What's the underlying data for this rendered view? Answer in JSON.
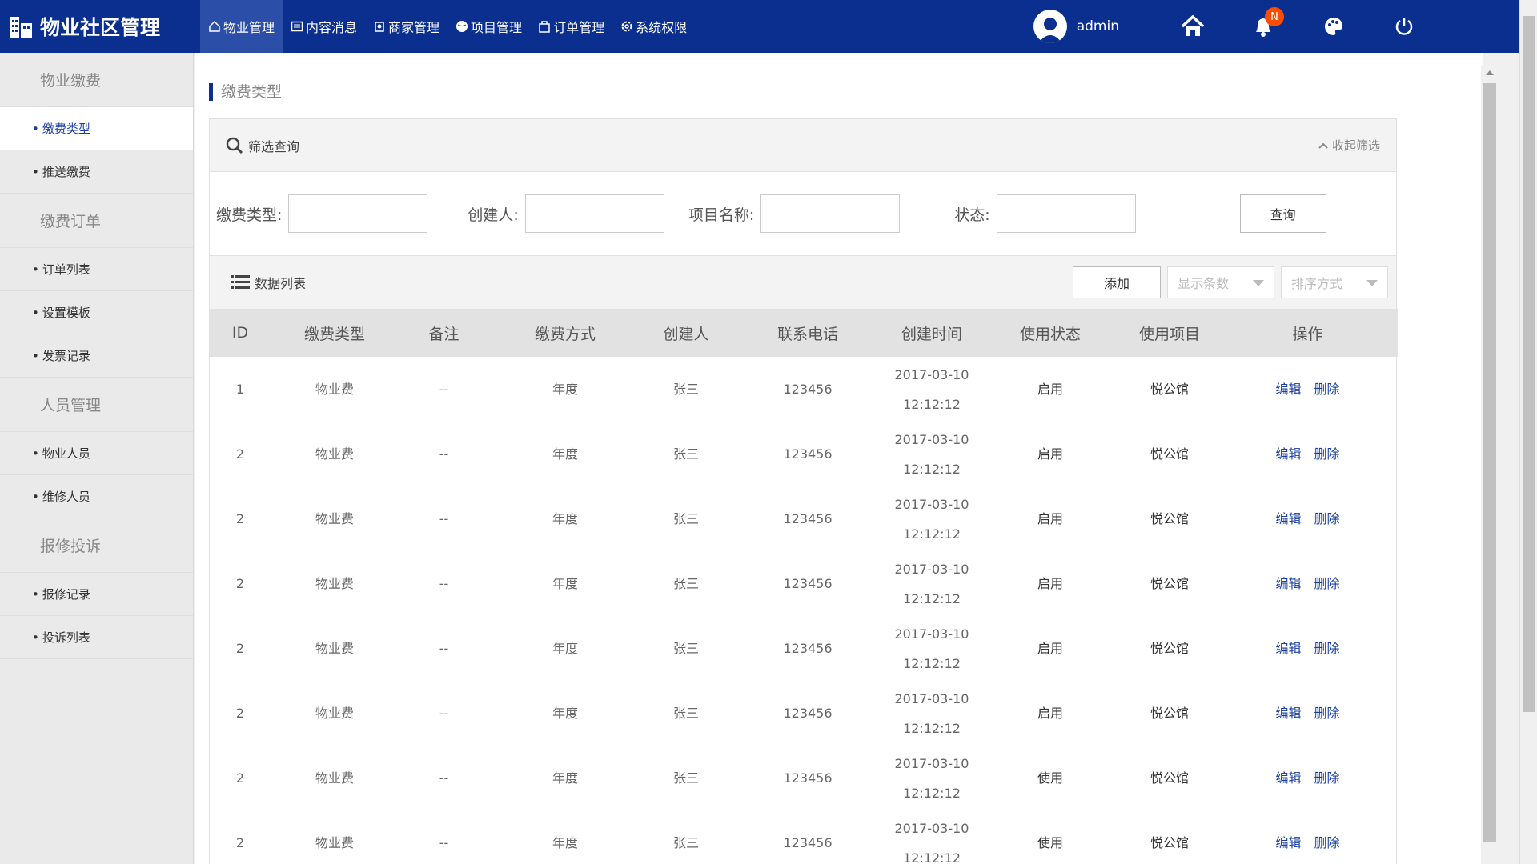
{
  "app": {
    "title": "物业社区管理"
  },
  "nav": {
    "items": [
      {
        "label": "物业管理",
        "icon": "home-outline-icon"
      },
      {
        "label": "内容消息",
        "icon": "message-icon"
      },
      {
        "label": "商家管理",
        "icon": "shop-icon"
      },
      {
        "label": "项目管理",
        "icon": "globe-icon"
      },
      {
        "label": "订单管理",
        "icon": "bag-icon"
      },
      {
        "label": "系统权限",
        "icon": "gear-icon"
      }
    ]
  },
  "user": {
    "name": "admin",
    "notifications_badge": "N"
  },
  "sidebar": {
    "groups": [
      {
        "title": "物业缴费",
        "items": [
          "缴费类型",
          "推送缴费"
        ]
      },
      {
        "title": "缴费订单",
        "items": [
          "订单列表",
          "设置模板",
          "发票记录"
        ]
      },
      {
        "title": "人员管理",
        "items": [
          "物业人员",
          "维修人员"
        ]
      },
      {
        "title": "报修投诉",
        "items": [
          "报修记录",
          "投诉列表"
        ]
      }
    ],
    "bullet": "•"
  },
  "page": {
    "title": "缴费类型"
  },
  "filter": {
    "title": "筛选查询",
    "collapse_label": "收起筛选",
    "fields": [
      "缴费类型:",
      "创建人:",
      "项目名称:",
      "状态:"
    ],
    "query_button": "查询"
  },
  "list": {
    "title": "数据列表",
    "add_button": "添加",
    "show_count_placeholder": "显示条数",
    "sort_placeholder": "排序方式",
    "columns": [
      "ID",
      "缴费类型",
      "备注",
      "缴费方式",
      "创建人",
      "联系电话",
      "创建时间",
      "使用状态",
      "使用项目",
      "操作"
    ],
    "rows": [
      {
        "id": "1",
        "type": "物业费",
        "note": "--",
        "method": "年度",
        "creator": "张三",
        "phone": "123456",
        "date": "2017-03-10",
        "time": "12:12:12",
        "status": "启用",
        "project": "悦公馆"
      },
      {
        "id": "2",
        "type": "物业费",
        "note": "--",
        "method": "年度",
        "creator": "张三",
        "phone": "123456",
        "date": "2017-03-10",
        "time": "12:12:12",
        "status": "启用",
        "project": "悦公馆"
      },
      {
        "id": "2",
        "type": "物业费",
        "note": "--",
        "method": "年度",
        "creator": "张三",
        "phone": "123456",
        "date": "2017-03-10",
        "time": "12:12:12",
        "status": "启用",
        "project": "悦公馆"
      },
      {
        "id": "2",
        "type": "物业费",
        "note": "--",
        "method": "年度",
        "creator": "张三",
        "phone": "123456",
        "date": "2017-03-10",
        "time": "12:12:12",
        "status": "启用",
        "project": "悦公馆"
      },
      {
        "id": "2",
        "type": "物业费",
        "note": "--",
        "method": "年度",
        "creator": "张三",
        "phone": "123456",
        "date": "2017-03-10",
        "time": "12:12:12",
        "status": "启用",
        "project": "悦公馆"
      },
      {
        "id": "2",
        "type": "物业费",
        "note": "--",
        "method": "年度",
        "creator": "张三",
        "phone": "123456",
        "date": "2017-03-10",
        "time": "12:12:12",
        "status": "启用",
        "project": "悦公馆"
      },
      {
        "id": "2",
        "type": "物业费",
        "note": "--",
        "method": "年度",
        "creator": "张三",
        "phone": "123456",
        "date": "2017-03-10",
        "time": "12:12:12",
        "status": "使用",
        "project": "悦公馆"
      },
      {
        "id": "2",
        "type": "物业费",
        "note": "--",
        "method": "年度",
        "creator": "张三",
        "phone": "123456",
        "date": "2017-03-10",
        "time": "12:12:12",
        "status": "使用",
        "project": "悦公馆"
      }
    ],
    "edit_label": "编辑",
    "delete_label": "删除"
  },
  "colors": {
    "brand": "#0b2f8e",
    "link": "#1a3fa3",
    "badge": "#ff4d00"
  }
}
